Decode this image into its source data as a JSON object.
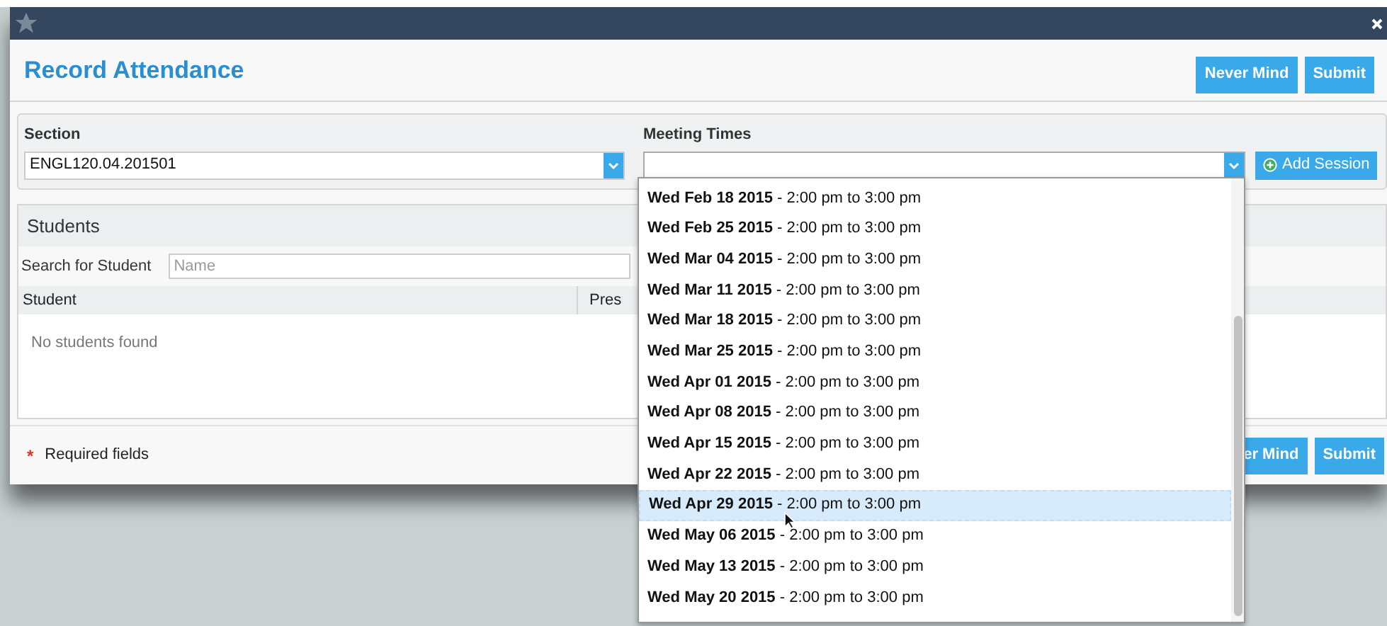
{
  "dialog": {
    "title": "Record Attendance",
    "header_buttons": [
      "Never Mind",
      "Submit"
    ]
  },
  "section": {
    "label": "Section",
    "value": "ENGL120.04.201501"
  },
  "meeting_times": {
    "label": "Meeting Times",
    "add_button": "Add Session",
    "options": [
      {
        "text": "**Wed Feb 18 2015** - 2:00 pm to 3:00 pm",
        "selected": false
      },
      {
        "text": "**Wed Feb 25 2015** - 2:00 pm to 3:00 pm",
        "selected": false
      },
      {
        "text": "**Wed Mar 04 2015** - 2:00 pm to 3:00 pm",
        "selected": false
      },
      {
        "text": "**Wed Mar 11 2015** - 2:00 pm to 3:00 pm",
        "selected": false
      },
      {
        "text": "**Wed Mar 18 2015** - 2:00 pm to 3:00 pm",
        "selected": false
      },
      {
        "text": "**Wed Mar 25 2015** - 2:00 pm to 3:00 pm",
        "selected": false
      },
      {
        "text": "**Wed Apr 01 2015** - 2:00 pm to 3:00 pm",
        "selected": false
      },
      {
        "text": "**Wed Apr 08 2015** - 2:00 pm to 3:00 pm",
        "selected": false
      },
      {
        "text": "**Wed Apr 15 2015** - 2:00 pm to 3:00 pm",
        "selected": false
      },
      {
        "text": "**Wed Apr 22 2015** - 2:00 pm to 3:00 pm",
        "selected": false
      },
      {
        "text": "**Wed Apr 29 2015** - 2:00 pm to 3:00 pm",
        "selected": true
      },
      {
        "text": "**Wed May 06 2015** - 2:00 pm to 3:00 pm",
        "selected": false
      },
      {
        "text": "**Wed May 13 2015** - 2:00 pm to 3:00 pm",
        "selected": false
      },
      {
        "text": "**Wed May 20 2015** - 2:00 pm to 3:00 pm",
        "selected": false
      }
    ]
  },
  "students": {
    "title": "Students",
    "search_label": "Search for Student",
    "search_placeholder": "Name",
    "columns": [
      "Student",
      "Pres"
    ],
    "empty_message": "No students found"
  },
  "footer": {
    "required_mark": "*",
    "required_note": "Required fields",
    "buttons": [
      "er Mind",
      "Submit"
    ]
  }
}
